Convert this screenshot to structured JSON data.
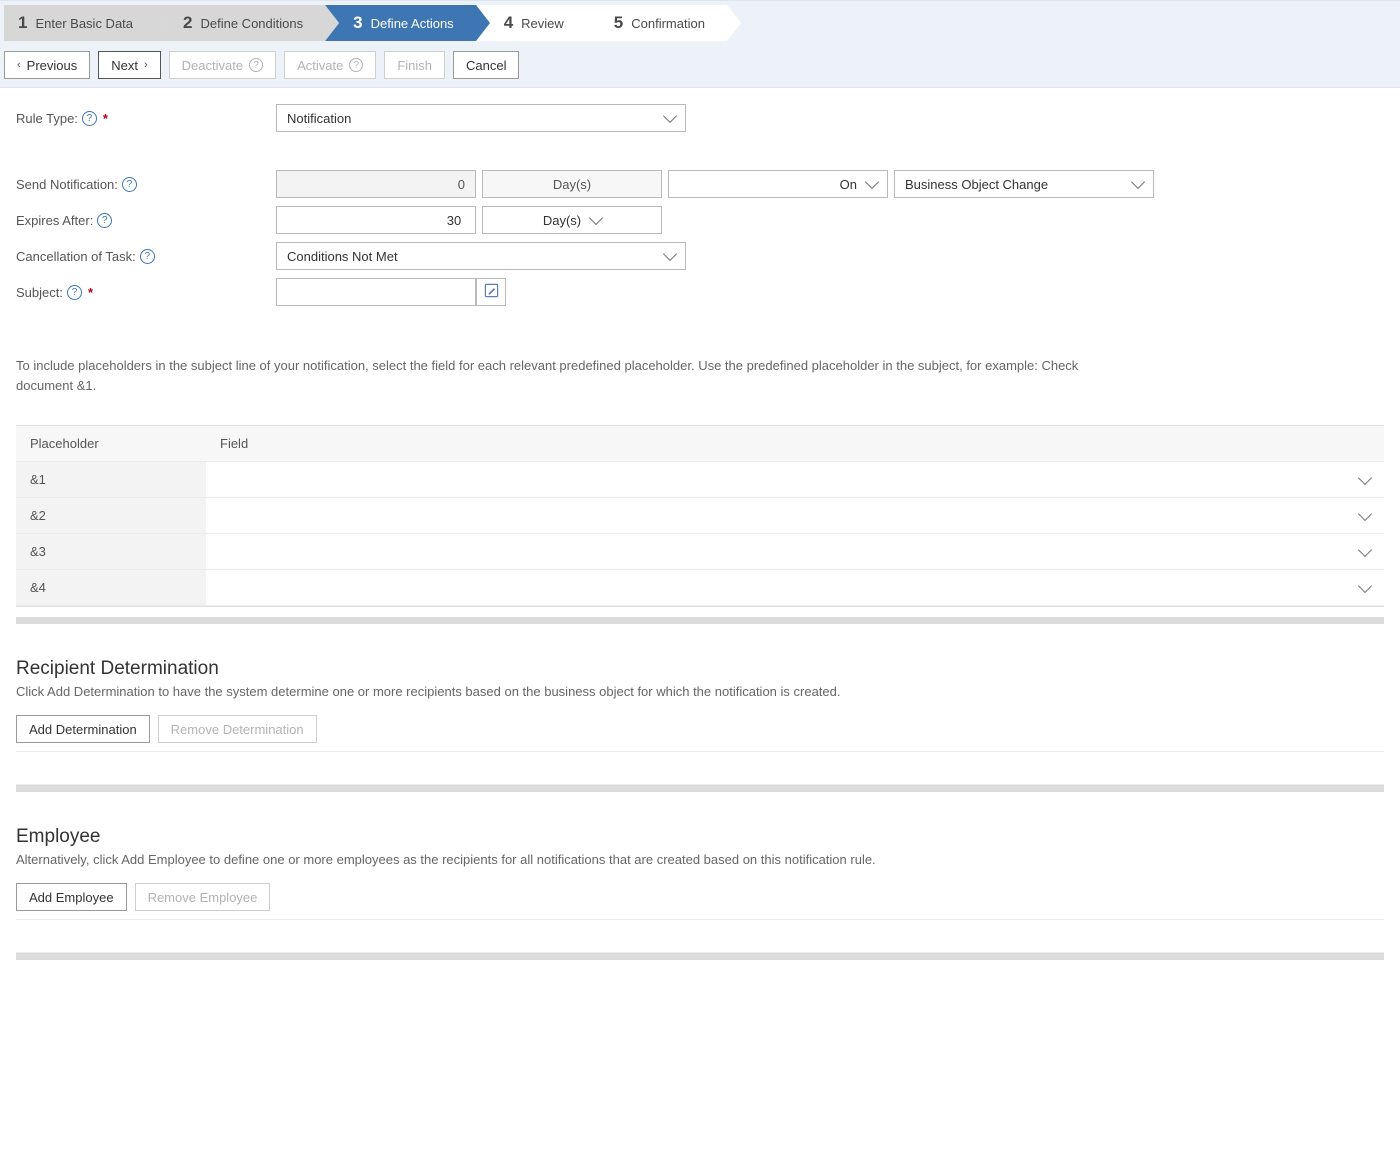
{
  "wizard": {
    "steps": [
      {
        "num": "1",
        "label": "Enter Basic Data"
      },
      {
        "num": "2",
        "label": "Define Conditions"
      },
      {
        "num": "3",
        "label": "Define Actions"
      },
      {
        "num": "4",
        "label": "Review"
      },
      {
        "num": "5",
        "label": "Confirmation"
      }
    ],
    "active_index": 2
  },
  "toolbar": {
    "previous": "Previous",
    "next": "Next",
    "deactivate": "Deactivate",
    "activate": "Activate",
    "finish": "Finish",
    "cancel": "Cancel"
  },
  "labels": {
    "rule_type": "Rule Type:",
    "send_notification": "Send Notification:",
    "expires_after": "Expires After:",
    "cancellation": "Cancellation of Task:",
    "subject": "Subject:"
  },
  "fields": {
    "rule_type": "Notification",
    "send_offset": "0",
    "send_unit": "Day(s)",
    "send_relation": "On",
    "send_event": "Business Object Change",
    "expires_value": "30",
    "expires_unit": "Day(s)",
    "cancellation": "Conditions Not Met",
    "subject": ""
  },
  "hint": "To include placeholders in the subject line of your notification, select the field for each relevant predefined placeholder. Use the predefined placeholder in the subject, for example: Check document &1.",
  "placeholder_table": {
    "col_placeholder": "Placeholder",
    "col_field": "Field",
    "rows": [
      {
        "ph": "&1",
        "field": ""
      },
      {
        "ph": "&2",
        "field": ""
      },
      {
        "ph": "&3",
        "field": ""
      },
      {
        "ph": "&4",
        "field": ""
      }
    ]
  },
  "recipient": {
    "title": "Recipient Determination",
    "desc": "Click Add Determination to have the system determine one or more recipients based on the business object for which the notification is created.",
    "add": "Add Determination",
    "remove": "Remove Determination"
  },
  "employee": {
    "title": "Employee",
    "desc": "Alternatively, click Add Employee to define one or more employees as the recipients for all notifications that are created based on this notification rule.",
    "add": "Add Employee",
    "remove": "Remove Employee"
  }
}
